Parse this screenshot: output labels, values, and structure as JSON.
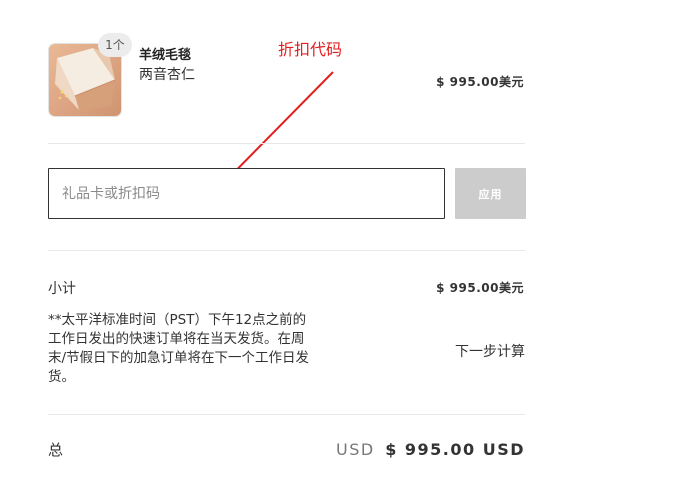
{
  "order_summary": {
    "item": {
      "quantity_badge": "1个",
      "name": "羊绒毛毯",
      "variant": "两音杏仁",
      "price": "$ 995.00美元"
    },
    "discount": {
      "placeholder": "礼品卡或折扣码",
      "apply_label": "应用"
    },
    "subtotal": {
      "label": "小计",
      "value": "$ 995.00美元"
    },
    "shipping": {
      "note": "**太平洋标准时间（PST）下午12点之前的工作日发出的快速订单将在当天发货。在周末/节假日下的加急订单将在下一个工作日发货。",
      "value": "下一步计算"
    },
    "total": {
      "label": "总",
      "currency": "USD",
      "value": "$ 995.00 USD"
    }
  },
  "annotation": {
    "text": "折扣代码",
    "color": "#e41e1e"
  },
  "icons": {
    "product_thumbnail": "folded-blanket-image"
  }
}
